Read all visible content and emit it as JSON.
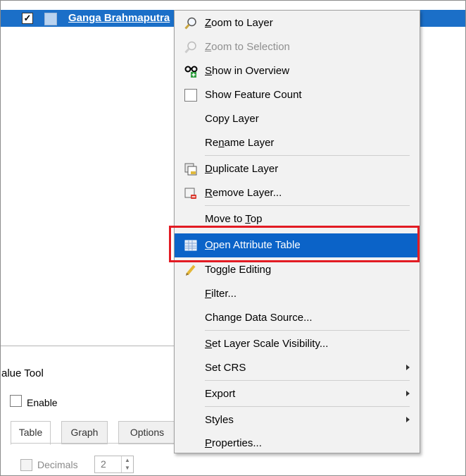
{
  "layers": {
    "item_name": "Ganga Brahmaputra",
    "checked": "✓"
  },
  "value_tool": {
    "title": "alue Tool",
    "enable_label": "Enable",
    "tabs": [
      "Table",
      "Graph",
      "Options"
    ],
    "active_tab": "Table",
    "decimals_label": "Decimals",
    "decimals_value": "2"
  },
  "menu": {
    "zoom_to_layer": {
      "pre": "",
      "u": "Z",
      "post": "oom to Layer"
    },
    "zoom_to_selection": {
      "pre": "",
      "u": "Z",
      "post": "oom to Selection"
    },
    "show_in_overview": {
      "pre": "",
      "u": "S",
      "post": "how in Overview"
    },
    "show_feature_count": {
      "pre": "Show Feature Count",
      "u": "",
      "post": ""
    },
    "copy_layer": {
      "pre": "Copy Layer",
      "u": "",
      "post": ""
    },
    "rename_layer": {
      "pre": "Re",
      "u": "n",
      "post": "ame Layer"
    },
    "duplicate_layer": {
      "pre": "",
      "u": "D",
      "post": "uplicate Layer"
    },
    "remove_layer": {
      "pre": "",
      "u": "R",
      "post": "emove Layer..."
    },
    "move_to_top": {
      "pre": "Move to ",
      "u": "T",
      "post": "op"
    },
    "open_attribute_table": {
      "pre": "",
      "u": "O",
      "post": "pen Attribute Table"
    },
    "toggle_editing": {
      "pre": "Toggle Editing",
      "u": "",
      "post": ""
    },
    "filter": {
      "pre": "",
      "u": "F",
      "post": "ilter..."
    },
    "change_data_source": {
      "pre": "Change Data Source...",
      "u": "",
      "post": ""
    },
    "set_layer_scale_visibility": {
      "pre": "",
      "u": "S",
      "post": "et Layer Scale Visibility..."
    },
    "set_crs": {
      "pre": "Set CRS",
      "u": "",
      "post": ""
    },
    "export": {
      "pre": "Export",
      "u": "",
      "post": ""
    },
    "styles": {
      "pre": "Styles",
      "u": "",
      "post": ""
    },
    "properties": {
      "pre": "",
      "u": "P",
      "post": "roperties..."
    }
  },
  "colors": {
    "highlight": "#0b63c8",
    "annotation_box": "#e21b23",
    "layer_row": "#1b6fc8"
  },
  "icons": {
    "zoom_to_layer": "magnifier-icon",
    "zoom_to_selection": "magnifier-disabled-icon",
    "show_in_overview": "glasses-plus-icon",
    "duplicate_layer": "duplicate-layer-icon",
    "remove_layer": "remove-layer-icon",
    "open_attribute_table": "table-icon",
    "toggle_editing": "pencil-icon"
  }
}
